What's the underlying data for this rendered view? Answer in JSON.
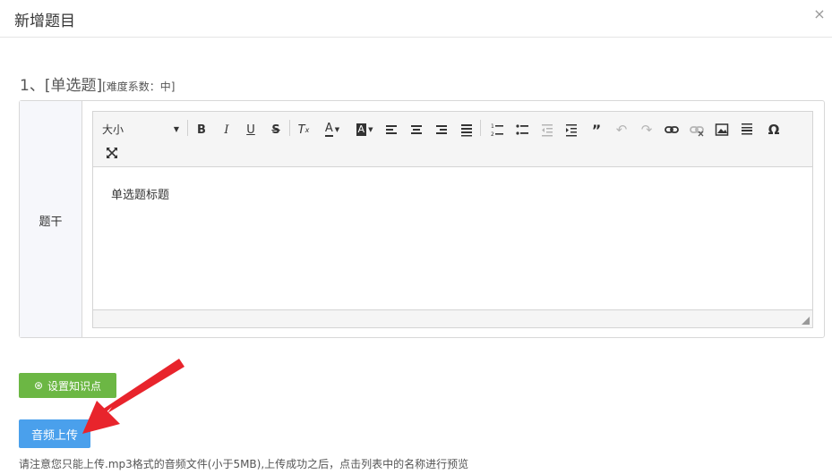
{
  "dialog": {
    "title": "新增题目",
    "close_glyph": "×"
  },
  "question": {
    "number_type": "1、[单选题]",
    "difficulty": "[难度系数：中]"
  },
  "form": {
    "label": "题干"
  },
  "editor": {
    "font_size_label": "大小",
    "content": "单选题标题",
    "toolbar_icons": [
      "bold-icon",
      "italic-icon",
      "underline-icon",
      "strikethrough-icon",
      "clear-format-icon",
      "font-color-icon",
      "highlight-icon",
      "align-left-icon",
      "align-center-icon",
      "align-right-icon",
      "align-justify-icon",
      "ordered-list-icon",
      "bullet-list-icon",
      "outdent-icon",
      "indent-icon",
      "blockquote-icon",
      "undo-icon",
      "redo-icon",
      "link-icon",
      "unlink-icon",
      "image-icon",
      "horizontal-rule-icon",
      "special-char-icon",
      "fullscreen-icon"
    ]
  },
  "buttons": {
    "knowledge": "设置知识点",
    "audio_upload": "音频上传"
  },
  "note": "请注意您只能上传.mp3格式的音频文件(小于5MB),上传成功之后，点击列表中的名称进行预览",
  "colors": {
    "green": "#6cb744",
    "blue": "#4aa0ec",
    "arrow": "#e8242c"
  }
}
